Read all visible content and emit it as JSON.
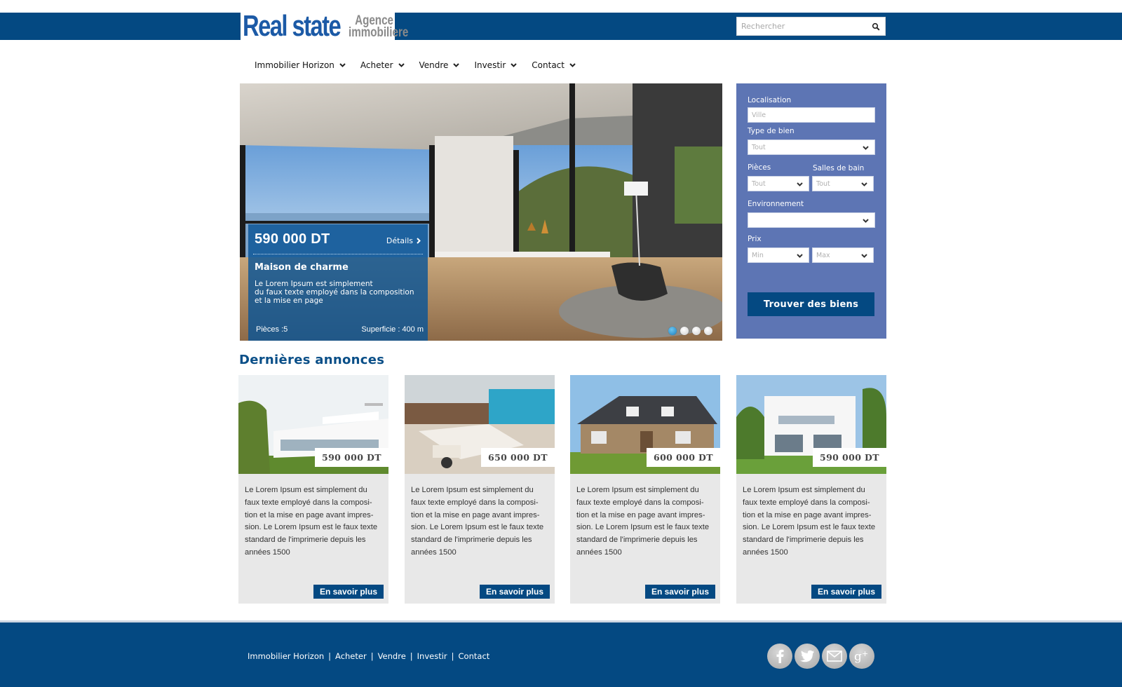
{
  "logo": {
    "main": "Real state",
    "sub_line1": "Agence",
    "sub_line2": "immobiliere"
  },
  "search": {
    "placeholder": "Rechercher",
    "icon": "search-icon"
  },
  "nav": {
    "items": [
      {
        "label": "Immobilier Horizon"
      },
      {
        "label": "Acheter"
      },
      {
        "label": "Vendre"
      },
      {
        "label": "Investir"
      },
      {
        "label": "Contact"
      }
    ]
  },
  "hero": {
    "price": "590 000 DT",
    "details_label": "Détails",
    "title": "Maison de charme",
    "desc_lines": [
      "Le Lorem Ipsum est simplement",
      "du faux texte employé dans la composition",
      "et la mise en page"
    ],
    "rooms": "Pièces :5",
    "area": "Superficie : 400 m",
    "slides": 4,
    "active_slide": 1
  },
  "search_panel": {
    "location_label": "Localisation",
    "location_placeholder": "Ville",
    "type_label": "Type de bien",
    "type_value": "Tout",
    "rooms_label": "Pièces",
    "rooms_value": "Tout",
    "baths_label": "Salles de bain",
    "baths_value": "Tout",
    "env_label": "Environnement",
    "env_value": "",
    "price_label": "Prix",
    "price_min": "Min",
    "price_max": "Max",
    "button": "Trouver des biens"
  },
  "listings": {
    "title": "Dernières annonces",
    "more_label": "En savoir plus",
    "items": [
      {
        "price": "590 000 DT",
        "desc": [
          "Le Lorem Ipsum est simplement du",
          "faux texte employé dans la composi-",
          "tion et la mise en page avant impres-",
          "sion. Le Lorem Ipsum est le faux texte",
          "standard de l'imprimerie depuis les",
          "années 1500"
        ]
      },
      {
        "price": "650 000 DT",
        "desc": [
          "Le Lorem Ipsum est simplement du",
          "faux texte employé dans la composi-",
          "tion et la mise en page avant impres-",
          "sion. Le Lorem Ipsum est le faux texte",
          "standard de l'imprimerie depuis les",
          "années 1500"
        ]
      },
      {
        "price": "600 000 DT",
        "desc": [
          "Le Lorem Ipsum est simplement du",
          "faux texte employé dans la composi-",
          "tion et la mise en page avant impres-",
          "sion. Le Lorem Ipsum est le faux texte",
          "standard de l'imprimerie depuis les",
          "années 1500"
        ]
      },
      {
        "price": "590 000 DT",
        "desc": [
          "Le Lorem Ipsum est simplement du",
          "faux texte employé dans la composi-",
          "tion et la mise en page avant impres-",
          "sion. Le Lorem Ipsum est le faux texte",
          "standard de l'imprimerie depuis les",
          "années 1500"
        ]
      }
    ]
  },
  "footer": {
    "links": [
      {
        "label": "Immobilier Horizon"
      },
      {
        "label": "Acheter"
      },
      {
        "label": "Vendre"
      },
      {
        "label": "Investir"
      },
      {
        "label": "Contact"
      }
    ],
    "separator": "|",
    "social": [
      "facebook-icon",
      "twitter-icon",
      "mail-icon",
      "google-plus-icon"
    ]
  },
  "colors": {
    "primary": "#044982",
    "panel": "#5d75b4",
    "card_bg": "#e8e8e8",
    "heading": "#0a4f88"
  }
}
